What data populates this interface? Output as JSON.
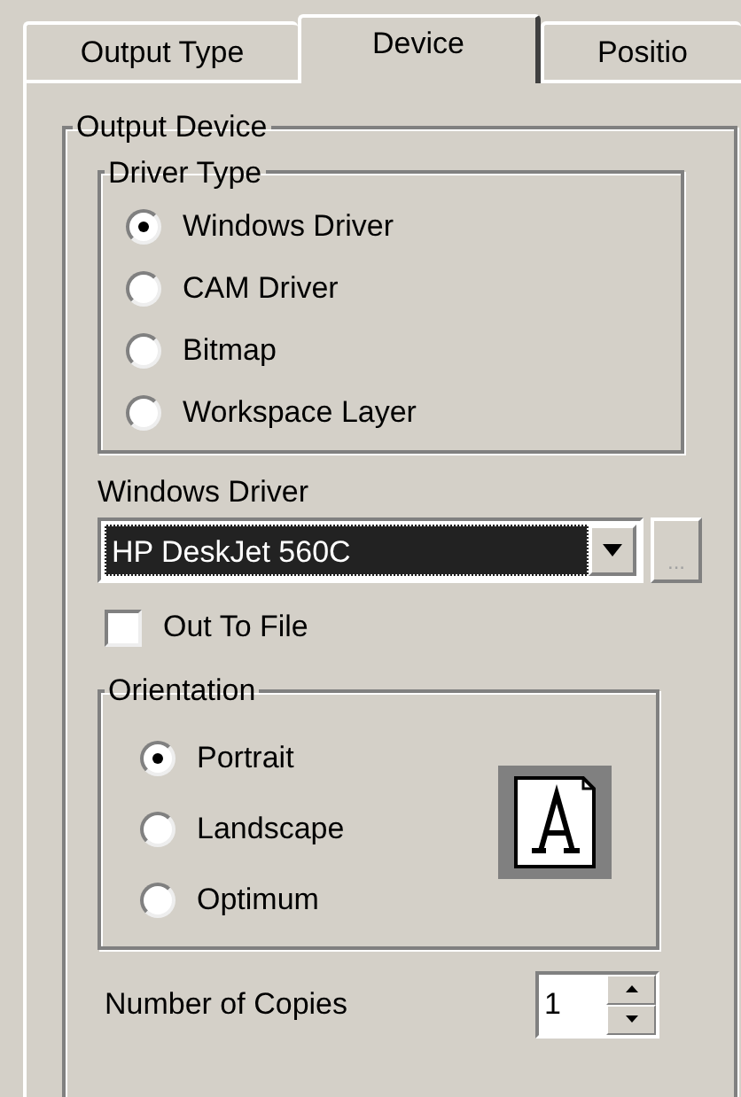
{
  "tabs": [
    {
      "label": "Output Type",
      "selected": false
    },
    {
      "label": "Device",
      "selected": true
    },
    {
      "label": "Positio",
      "selected": false
    }
  ],
  "output_device": {
    "title": "Output Device",
    "driver_type": {
      "title": "Driver Type",
      "options": [
        {
          "label": "Windows Driver",
          "selected": true
        },
        {
          "label": "CAM Driver",
          "selected": false
        },
        {
          "label": "Bitmap",
          "selected": false
        },
        {
          "label": "Workspace Layer",
          "selected": false
        }
      ]
    },
    "windows_driver": {
      "label": "Windows Driver",
      "value": "HP DeskJet 560C",
      "browse_button": "..."
    },
    "out_to_file": {
      "label": "Out To File",
      "checked": false
    },
    "orientation": {
      "title": "Orientation",
      "options": [
        {
          "label": "Portrait",
          "selected": true
        },
        {
          "label": "Landscape",
          "selected": false
        },
        {
          "label": "Optimum",
          "selected": false
        }
      ]
    },
    "number_of_copies": {
      "label": "Number of Copies",
      "value": "1"
    }
  }
}
